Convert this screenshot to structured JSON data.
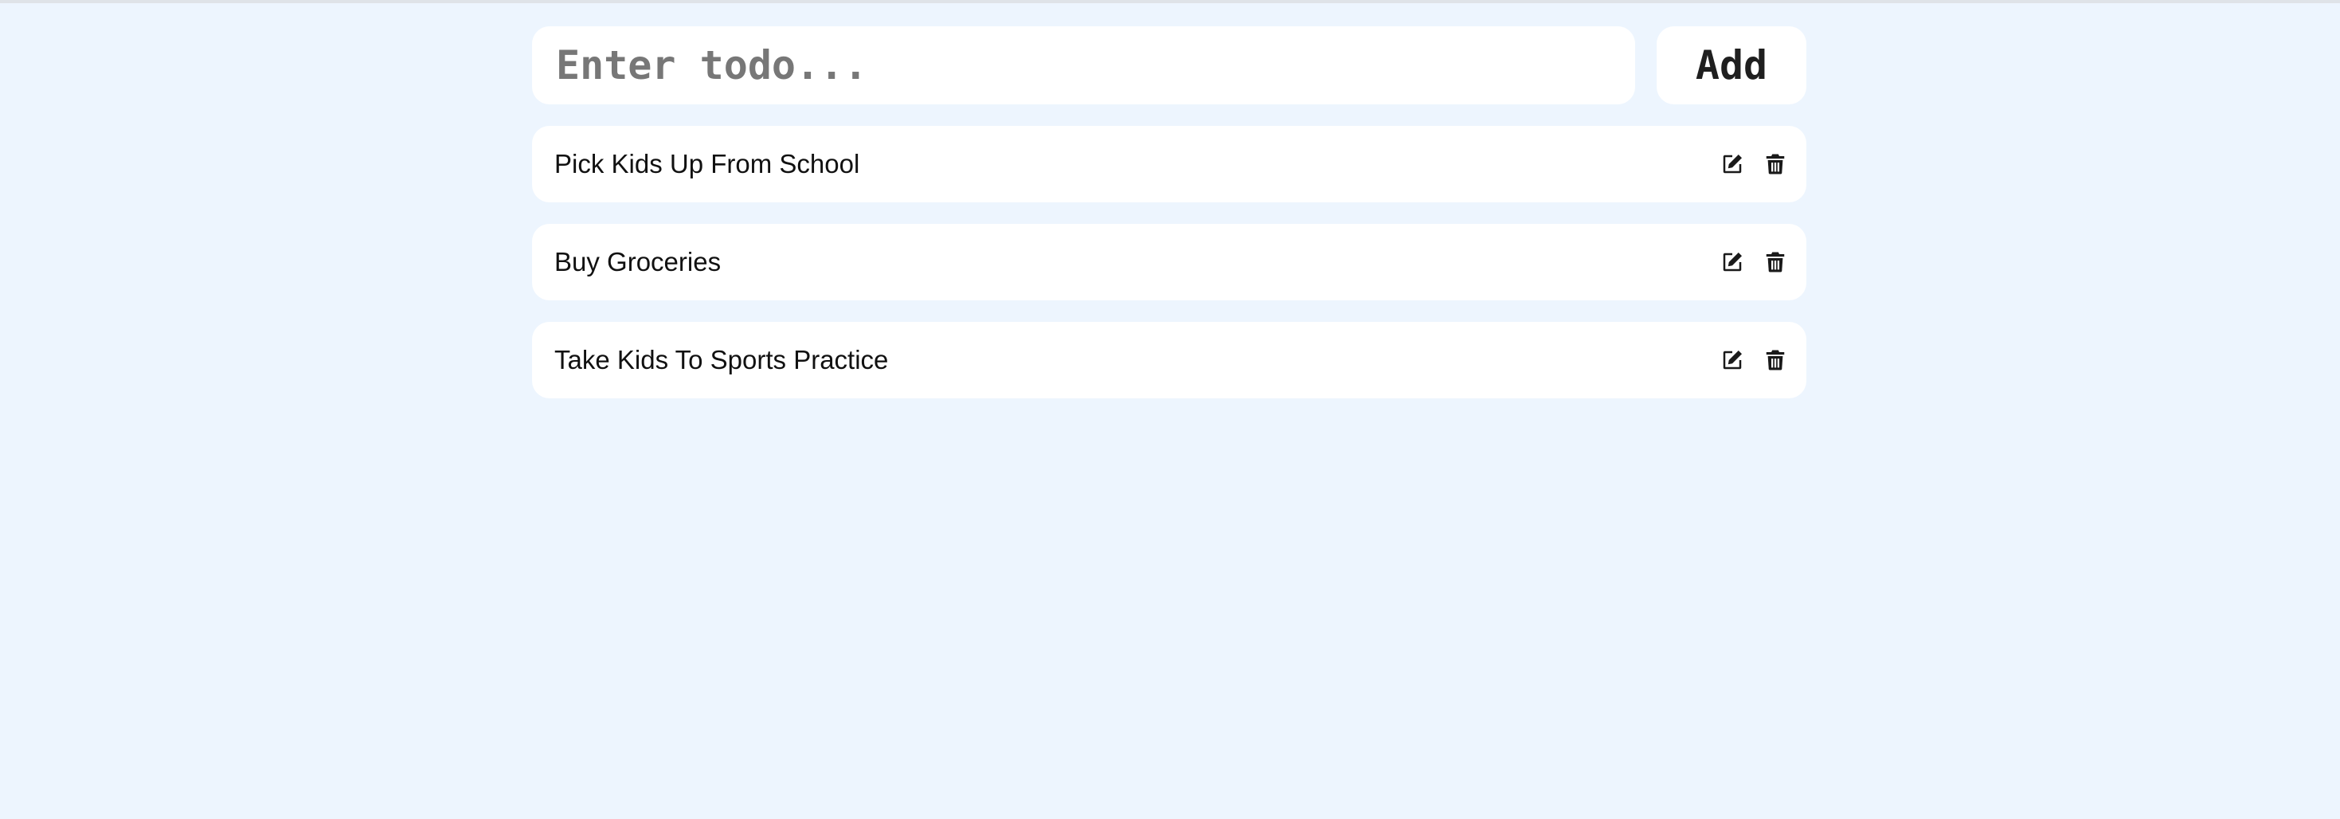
{
  "form": {
    "input_value": "",
    "input_placeholder": "Enter todo...",
    "add_label": "Add"
  },
  "todos": [
    {
      "text": "Pick Kids Up From School",
      "edit_icon": "edit-icon",
      "delete_icon": "trash-icon"
    },
    {
      "text": "Buy Groceries",
      "edit_icon": "edit-icon",
      "delete_icon": "trash-icon"
    },
    {
      "text": "Take Kids To Sports Practice",
      "edit_icon": "edit-icon",
      "delete_icon": "trash-icon"
    }
  ],
  "colors": {
    "background": "#edf5fe",
    "card": "#ffffff",
    "text": "#111111",
    "placeholder": "#777777"
  }
}
